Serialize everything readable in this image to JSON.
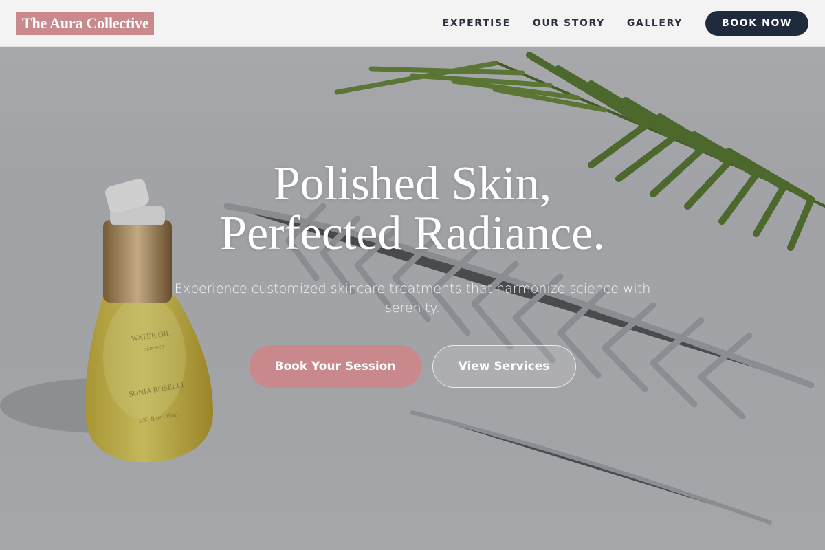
{
  "header": {
    "logo": "The Aura Collective",
    "nav": [
      "EXPERTISE",
      "OUR STORY",
      "GALLERY"
    ],
    "book_now": "BOOK NOW"
  },
  "hero": {
    "headline_line1": "Polished Skin,",
    "headline_line2": "Perfected Radiance.",
    "subtext": "Experience customized skincare treatments that harmonize science with serenity.",
    "primary_cta": "Book Your Session",
    "secondary_cta": "View Services",
    "bottle_label": {
      "name": "WATER OIL",
      "sub": "SKIN FAST",
      "brand": "SONIA ROSELLI",
      "volume": "1.52 fl oz (45ml)"
    }
  },
  "colors": {
    "logo_bg": "#c98a8d",
    "primary_button": "#c9888b",
    "book_now_bg": "#1f2a3d",
    "nav_text": "#2b3140"
  },
  "icons": [
    "palm-leaf-image",
    "serum-bottle-image"
  ]
}
